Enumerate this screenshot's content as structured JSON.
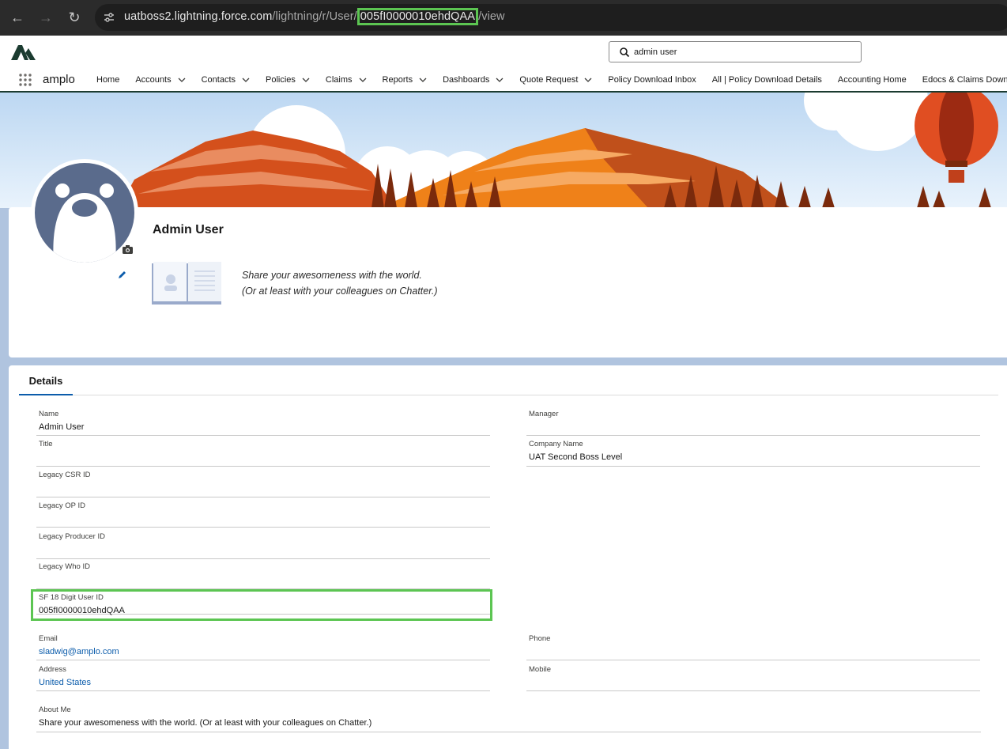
{
  "browser": {
    "url_host": "uatboss2.lightning.force.com",
    "url_path_prefix": "/lightning/r/User/",
    "url_highlight": "005fI0000010ehdQAA",
    "url_suffix": "/view"
  },
  "header": {
    "app_name": "amplo",
    "search_value": "admin user",
    "nav": [
      {
        "label": "Home",
        "has_menu": false
      },
      {
        "label": "Accounts",
        "has_menu": true
      },
      {
        "label": "Contacts",
        "has_menu": true
      },
      {
        "label": "Policies",
        "has_menu": true
      },
      {
        "label": "Claims",
        "has_menu": true
      },
      {
        "label": "Reports",
        "has_menu": true
      },
      {
        "label": "Dashboards",
        "has_menu": true
      },
      {
        "label": "Quote Request",
        "has_menu": true
      },
      {
        "label": "Policy Download Inbox",
        "has_menu": false
      },
      {
        "label": "All | Policy Download Details",
        "has_menu": false
      },
      {
        "label": "Accounting Home",
        "has_menu": false
      },
      {
        "label": "Edocs & Claims Downl",
        "has_menu": false
      }
    ]
  },
  "profile": {
    "name": "Admin User",
    "share_line1": "Share your awesomeness with the world.",
    "share_line2": "(Or at least with your colleagues on Chatter.)"
  },
  "details": {
    "tab_label": "Details",
    "left_fields": [
      {
        "label": "Name",
        "value": "Admin User",
        "link": false
      },
      {
        "label": "Title",
        "value": "",
        "link": false
      },
      {
        "label": "Legacy CSR ID",
        "value": "",
        "link": false
      },
      {
        "label": "Legacy OP ID",
        "value": "",
        "link": false
      },
      {
        "label": "Legacy Producer ID",
        "value": "",
        "link": false
      },
      {
        "label": "Legacy Who ID",
        "value": "",
        "link": false
      },
      {
        "label": "SF 18 Digit User ID",
        "value": "005fI0000010ehdQAA",
        "link": false
      },
      {
        "label": "Email",
        "value": "sladwig@amplo.com",
        "link": true
      },
      {
        "label": "Address",
        "value": "United States",
        "link": true
      }
    ],
    "right_fields": [
      {
        "label": "Manager",
        "value": "",
        "link": false
      },
      {
        "label": "Company Name",
        "value": "UAT Second Boss Level",
        "link": false
      },
      {
        "label": "Phone",
        "value": "",
        "link": false
      },
      {
        "label": "Mobile",
        "value": "",
        "link": false
      }
    ],
    "about": {
      "label": "About Me",
      "value": "Share your awesomeness with the world. (Or at least with your colleagues on Chatter.)"
    }
  },
  "colors": {
    "highlight": "#5cc552",
    "brand_dark": "#1b3b30",
    "link": "#0b5cab"
  }
}
